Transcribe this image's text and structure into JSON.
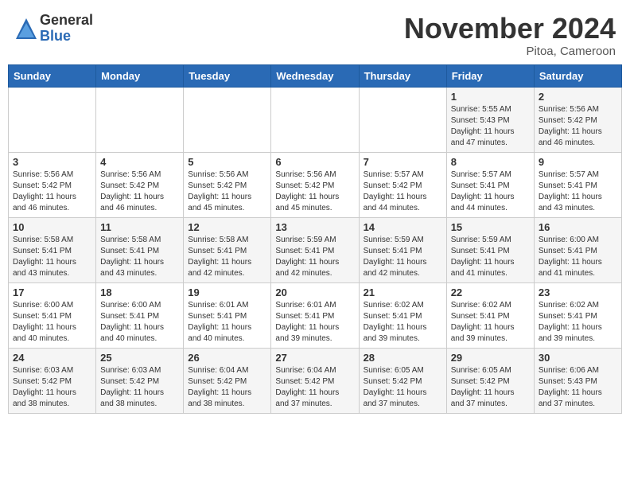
{
  "header": {
    "logo_general": "General",
    "logo_blue": "Blue",
    "month_title": "November 2024",
    "location": "Pitoa, Cameroon"
  },
  "weekdays": [
    "Sunday",
    "Monday",
    "Tuesday",
    "Wednesday",
    "Thursday",
    "Friday",
    "Saturday"
  ],
  "weeks": [
    [
      {
        "day": "",
        "info": ""
      },
      {
        "day": "",
        "info": ""
      },
      {
        "day": "",
        "info": ""
      },
      {
        "day": "",
        "info": ""
      },
      {
        "day": "",
        "info": ""
      },
      {
        "day": "1",
        "info": "Sunrise: 5:55 AM\nSunset: 5:43 PM\nDaylight: 11 hours\nand 47 minutes."
      },
      {
        "day": "2",
        "info": "Sunrise: 5:56 AM\nSunset: 5:42 PM\nDaylight: 11 hours\nand 46 minutes."
      }
    ],
    [
      {
        "day": "3",
        "info": "Sunrise: 5:56 AM\nSunset: 5:42 PM\nDaylight: 11 hours\nand 46 minutes."
      },
      {
        "day": "4",
        "info": "Sunrise: 5:56 AM\nSunset: 5:42 PM\nDaylight: 11 hours\nand 46 minutes."
      },
      {
        "day": "5",
        "info": "Sunrise: 5:56 AM\nSunset: 5:42 PM\nDaylight: 11 hours\nand 45 minutes."
      },
      {
        "day": "6",
        "info": "Sunrise: 5:56 AM\nSunset: 5:42 PM\nDaylight: 11 hours\nand 45 minutes."
      },
      {
        "day": "7",
        "info": "Sunrise: 5:57 AM\nSunset: 5:42 PM\nDaylight: 11 hours\nand 44 minutes."
      },
      {
        "day": "8",
        "info": "Sunrise: 5:57 AM\nSunset: 5:41 PM\nDaylight: 11 hours\nand 44 minutes."
      },
      {
        "day": "9",
        "info": "Sunrise: 5:57 AM\nSunset: 5:41 PM\nDaylight: 11 hours\nand 43 minutes."
      }
    ],
    [
      {
        "day": "10",
        "info": "Sunrise: 5:58 AM\nSunset: 5:41 PM\nDaylight: 11 hours\nand 43 minutes."
      },
      {
        "day": "11",
        "info": "Sunrise: 5:58 AM\nSunset: 5:41 PM\nDaylight: 11 hours\nand 43 minutes."
      },
      {
        "day": "12",
        "info": "Sunrise: 5:58 AM\nSunset: 5:41 PM\nDaylight: 11 hours\nand 42 minutes."
      },
      {
        "day": "13",
        "info": "Sunrise: 5:59 AM\nSunset: 5:41 PM\nDaylight: 11 hours\nand 42 minutes."
      },
      {
        "day": "14",
        "info": "Sunrise: 5:59 AM\nSunset: 5:41 PM\nDaylight: 11 hours\nand 42 minutes."
      },
      {
        "day": "15",
        "info": "Sunrise: 5:59 AM\nSunset: 5:41 PM\nDaylight: 11 hours\nand 41 minutes."
      },
      {
        "day": "16",
        "info": "Sunrise: 6:00 AM\nSunset: 5:41 PM\nDaylight: 11 hours\nand 41 minutes."
      }
    ],
    [
      {
        "day": "17",
        "info": "Sunrise: 6:00 AM\nSunset: 5:41 PM\nDaylight: 11 hours\nand 40 minutes."
      },
      {
        "day": "18",
        "info": "Sunrise: 6:00 AM\nSunset: 5:41 PM\nDaylight: 11 hours\nand 40 minutes."
      },
      {
        "day": "19",
        "info": "Sunrise: 6:01 AM\nSunset: 5:41 PM\nDaylight: 11 hours\nand 40 minutes."
      },
      {
        "day": "20",
        "info": "Sunrise: 6:01 AM\nSunset: 5:41 PM\nDaylight: 11 hours\nand 39 minutes."
      },
      {
        "day": "21",
        "info": "Sunrise: 6:02 AM\nSunset: 5:41 PM\nDaylight: 11 hours\nand 39 minutes."
      },
      {
        "day": "22",
        "info": "Sunrise: 6:02 AM\nSunset: 5:41 PM\nDaylight: 11 hours\nand 39 minutes."
      },
      {
        "day": "23",
        "info": "Sunrise: 6:02 AM\nSunset: 5:41 PM\nDaylight: 11 hours\nand 39 minutes."
      }
    ],
    [
      {
        "day": "24",
        "info": "Sunrise: 6:03 AM\nSunset: 5:42 PM\nDaylight: 11 hours\nand 38 minutes."
      },
      {
        "day": "25",
        "info": "Sunrise: 6:03 AM\nSunset: 5:42 PM\nDaylight: 11 hours\nand 38 minutes."
      },
      {
        "day": "26",
        "info": "Sunrise: 6:04 AM\nSunset: 5:42 PM\nDaylight: 11 hours\nand 38 minutes."
      },
      {
        "day": "27",
        "info": "Sunrise: 6:04 AM\nSunset: 5:42 PM\nDaylight: 11 hours\nand 37 minutes."
      },
      {
        "day": "28",
        "info": "Sunrise: 6:05 AM\nSunset: 5:42 PM\nDaylight: 11 hours\nand 37 minutes."
      },
      {
        "day": "29",
        "info": "Sunrise: 6:05 AM\nSunset: 5:42 PM\nDaylight: 11 hours\nand 37 minutes."
      },
      {
        "day": "30",
        "info": "Sunrise: 6:06 AM\nSunset: 5:43 PM\nDaylight: 11 hours\nand 37 minutes."
      }
    ]
  ]
}
